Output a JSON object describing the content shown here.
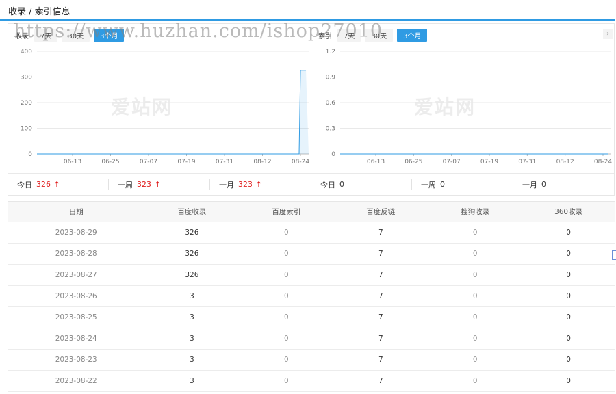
{
  "header": {
    "title": "收录 / 索引信息"
  },
  "left_panel": {
    "label": "收录",
    "tabs": [
      "7天",
      "30天",
      "3个月"
    ],
    "active_tab": 2,
    "stats": [
      {
        "label": "今日",
        "value": "326"
      },
      {
        "label": "一周",
        "value": "323"
      },
      {
        "label": "一月",
        "value": "323"
      }
    ]
  },
  "right_panel": {
    "label": "索引",
    "tabs": [
      "7天",
      "30天",
      "3个月"
    ],
    "active_tab": 2,
    "stats": [
      {
        "label": "今日",
        "value": "0"
      },
      {
        "label": "一周",
        "value": "0"
      },
      {
        "label": "一月",
        "value": "0"
      }
    ]
  },
  "watermark_text": "爱站网",
  "url_watermark": "https://www.huzhan.com/ishop27010",
  "colors": {
    "accent": "#2f9be3",
    "up": "#e02020"
  },
  "chart_data": [
    {
      "type": "area",
      "x_ticks": [
        "06-13",
        "06-25",
        "07-07",
        "07-19",
        "07-31",
        "08-12",
        "08-24"
      ],
      "y_ticks": [
        "0",
        "100",
        "200",
        "300",
        "400"
      ],
      "ylim": [
        0,
        400
      ],
      "series": [
        {
          "values": [
            0,
            0,
            0,
            0,
            0,
            0,
            0,
            326,
            326
          ]
        }
      ]
    },
    {
      "type": "line",
      "x_ticks": [
        "06-13",
        "06-25",
        "07-07",
        "07-19",
        "07-31",
        "08-12",
        "08-24"
      ],
      "y_ticks": [
        "0",
        "0.3",
        "0.6",
        "0.9",
        "1.2"
      ],
      "ylim": [
        0,
        1.2
      ],
      "series": [
        {
          "values": [
            0,
            0,
            0,
            0,
            0,
            0,
            0,
            0,
            0
          ]
        }
      ]
    }
  ],
  "table": {
    "columns": [
      "日期",
      "百度收录",
      "百度索引",
      "百度反链",
      "搜狗收录",
      "360收录"
    ],
    "rows": [
      [
        "2023-08-29",
        "326",
        "0",
        "7",
        "0",
        "0"
      ],
      [
        "2023-08-28",
        "326",
        "0",
        "7",
        "0",
        "0"
      ],
      [
        "2023-08-27",
        "326",
        "0",
        "7",
        "0",
        "0"
      ],
      [
        "2023-08-26",
        "3",
        "0",
        "7",
        "0",
        "0"
      ],
      [
        "2023-08-25",
        "3",
        "0",
        "7",
        "0",
        "0"
      ],
      [
        "2023-08-24",
        "3",
        "0",
        "7",
        "0",
        "0"
      ],
      [
        "2023-08-23",
        "3",
        "0",
        "7",
        "0",
        "0"
      ],
      [
        "2023-08-22",
        "3",
        "0",
        "7",
        "0",
        "0"
      ]
    ]
  }
}
